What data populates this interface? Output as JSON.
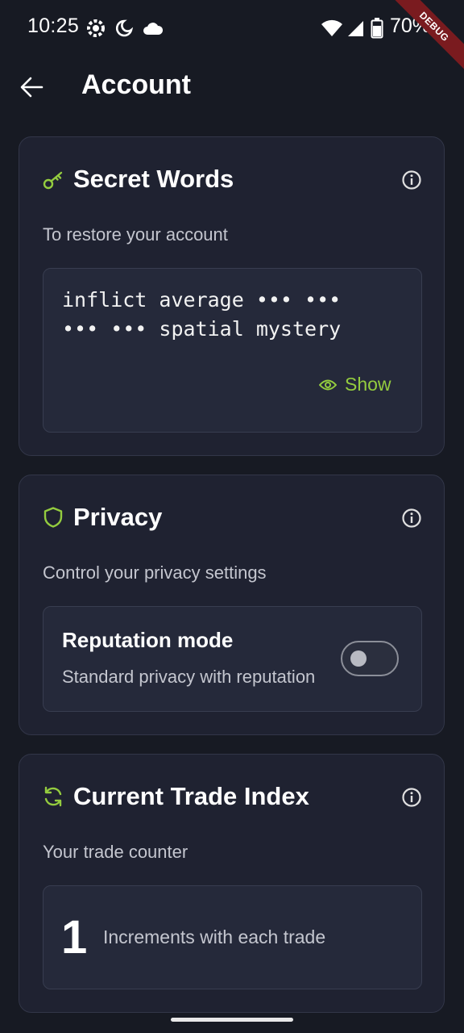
{
  "status_bar": {
    "time": "10:25",
    "battery": "70%",
    "debug_label": "DEBUG"
  },
  "app_bar": {
    "title": "Account",
    "back_icon": "arrow-left-icon"
  },
  "secret_words": {
    "title": "Secret Words",
    "icon": "key-icon",
    "subtitle": "To restore your account",
    "line1": "inflict average ••• •••",
    "line2": "••• ••• spatial mystery",
    "show_label": "Show"
  },
  "privacy": {
    "title": "Privacy",
    "icon": "shield-icon",
    "subtitle": "Control your privacy settings",
    "reputation_title": "Reputation mode",
    "reputation_desc": "Standard privacy with reputation",
    "reputation_enabled": false
  },
  "trade_index": {
    "title": "Current Trade Index",
    "icon": "refresh-icon",
    "subtitle": "Your trade counter",
    "value": "1",
    "description": "Increments with each trade"
  },
  "colors": {
    "background": "#171a23",
    "card": "#1f2231",
    "accent": "#94cc3f"
  }
}
